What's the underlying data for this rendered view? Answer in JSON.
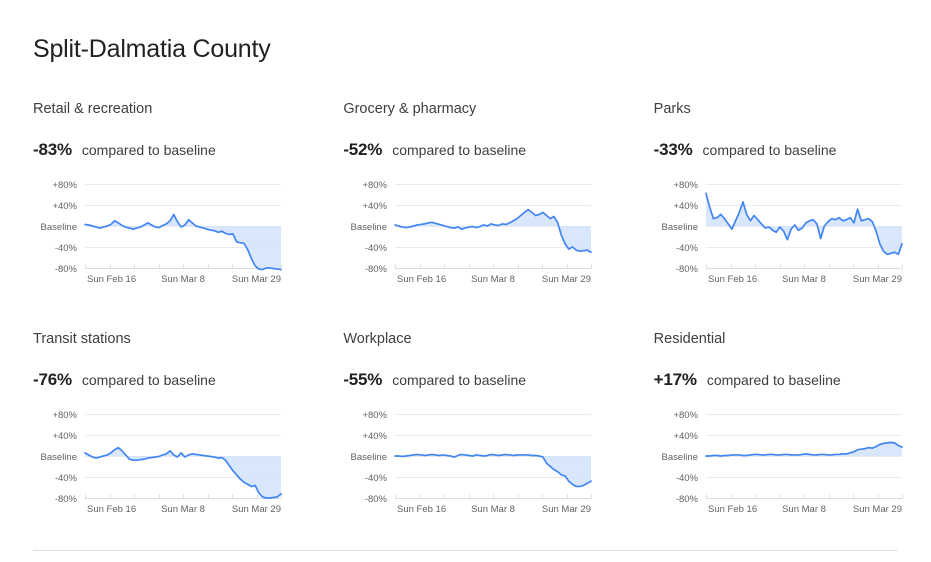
{
  "header": {
    "title": "Split-Dalmatia County"
  },
  "summary_caption": "compared to baseline",
  "axis": {
    "y_ticks": [
      "+80%",
      "+40%",
      "Baseline",
      "-40%",
      "-80%"
    ],
    "y_values": [
      80,
      40,
      0,
      -40,
      -80
    ],
    "x_ticks": [
      "Sun Feb 16",
      "Sun Mar 8",
      "Sun Mar 29"
    ]
  },
  "colors": {
    "line": "#4285f4",
    "area": "#d2e3fc",
    "gridline": "#e8eaed",
    "axis": "#dadce0",
    "text_primary": "#202124",
    "text_secondary": "#5f6368"
  },
  "chart_data": [
    {
      "type": "area",
      "title": "Retail & recreation",
      "value_label": "-83%",
      "caption": "compared to baseline",
      "xlabel": "",
      "ylabel": "",
      "ylim": [
        -80,
        80
      ],
      "grid": true,
      "legend": "none",
      "x_tick_labels": [
        "Sun Feb 16",
        "Sun Mar 8",
        "Sun Mar 29"
      ],
      "y_tick_labels": [
        "+80%",
        "+40%",
        "Baseline",
        "-40%",
        "-80%"
      ],
      "values": [
        3,
        2,
        0,
        -2,
        -4,
        -2,
        0,
        3,
        10,
        6,
        1,
        -2,
        -4,
        -6,
        -4,
        -2,
        2,
        6,
        2,
        -2,
        -3,
        1,
        4,
        10,
        22,
        8,
        -2,
        2,
        12,
        6,
        0,
        -2,
        -4,
        -6,
        -8,
        -9,
        -12,
        -10,
        -14,
        -16,
        -15,
        -30,
        -32,
        -33,
        -45,
        -62,
        -76,
        -82,
        -83,
        -80,
        -80,
        -81,
        -82,
        -83
      ]
    },
    {
      "type": "area",
      "title": "Grocery & pharmacy",
      "value_label": "-52%",
      "caption": "compared to baseline",
      "xlabel": "",
      "ylabel": "",
      "ylim": [
        -80,
        80
      ],
      "grid": true,
      "legend": "none",
      "x_tick_labels": [
        "Sun Feb 16",
        "Sun Mar 8",
        "Sun Mar 29"
      ],
      "y_tick_labels": [
        "+80%",
        "+40%",
        "Baseline",
        "-40%",
        "-80%"
      ],
      "values": [
        2,
        0,
        -2,
        -3,
        -2,
        0,
        2,
        3,
        4,
        6,
        7,
        5,
        3,
        1,
        -1,
        -3,
        -4,
        -2,
        -6,
        -4,
        -2,
        -1,
        -3,
        -1,
        2,
        0,
        4,
        2,
        1,
        4,
        3,
        6,
        10,
        14,
        20,
        26,
        31,
        26,
        20,
        22,
        26,
        20,
        14,
        18,
        6,
        -18,
        -34,
        -44,
        -40,
        -46,
        -48,
        -47,
        -46,
        -50
      ]
    },
    {
      "type": "area",
      "title": "Parks",
      "value_label": "-33%",
      "caption": "compared to baseline",
      "xlabel": "",
      "ylabel": "",
      "ylim": [
        -80,
        80
      ],
      "grid": true,
      "legend": "none",
      "x_tick_labels": [
        "Sun Feb 16",
        "Sun Mar 8",
        "Sun Mar 29"
      ],
      "y_tick_labels": [
        "+80%",
        "+40%",
        "Baseline",
        "-40%",
        "-80%"
      ],
      "values": [
        62,
        36,
        14,
        16,
        22,
        14,
        4,
        -6,
        10,
        26,
        46,
        22,
        10,
        20,
        12,
        4,
        -4,
        -2,
        -8,
        -12,
        -2,
        -10,
        -26,
        -6,
        2,
        -8,
        -4,
        6,
        10,
        12,
        4,
        -24,
        0,
        8,
        14,
        12,
        16,
        10,
        12,
        16,
        6,
        32,
        10,
        12,
        14,
        8,
        -10,
        -34,
        -48,
        -54,
        -52,
        -50,
        -54,
        -34
      ]
    },
    {
      "type": "area",
      "title": "Transit stations",
      "value_label": "-76%",
      "caption": "compared to baseline",
      "xlabel": "",
      "ylabel": "",
      "ylim": [
        -80,
        80
      ],
      "grid": true,
      "legend": "none",
      "x_tick_labels": [
        "Sun Feb 16",
        "Sun Mar 8",
        "Sun Mar 29"
      ],
      "y_tick_labels": [
        "+80%",
        "+40%",
        "Baseline",
        "-40%",
        "-80%"
      ],
      "values": [
        6,
        2,
        -2,
        -4,
        -2,
        0,
        2,
        6,
        12,
        16,
        10,
        2,
        -6,
        -8,
        -8,
        -7,
        -6,
        -4,
        -3,
        -2,
        -1,
        2,
        4,
        10,
        2,
        -2,
        6,
        -2,
        2,
        4,
        3,
        2,
        1,
        0,
        -1,
        -2,
        -4,
        -3,
        -8,
        -18,
        -28,
        -36,
        -44,
        -50,
        -54,
        -58,
        -56,
        -70,
        -78,
        -80,
        -80,
        -79,
        -78,
        -72
      ]
    },
    {
      "type": "area",
      "title": "Workplace",
      "value_label": "-55%",
      "caption": "compared to baseline",
      "xlabel": "",
      "ylabel": "",
      "ylim": [
        -80,
        80
      ],
      "grid": true,
      "legend": "none",
      "x_tick_labels": [
        "Sun Feb 16",
        "Sun Mar 8",
        "Sun Mar 29"
      ],
      "y_tick_labels": [
        "+80%",
        "+40%",
        "Baseline",
        "-40%",
        "-80%"
      ],
      "values": [
        0,
        0,
        -1,
        0,
        1,
        2,
        3,
        2,
        1,
        2,
        3,
        2,
        1,
        2,
        1,
        0,
        -2,
        1,
        3,
        2,
        1,
        0,
        2,
        1,
        0,
        1,
        3,
        2,
        1,
        2,
        3,
        2,
        1,
        2,
        2,
        2,
        2,
        1,
        1,
        0,
        -2,
        -14,
        -20,
        -26,
        -30,
        -36,
        -38,
        -48,
        -54,
        -58,
        -58,
        -56,
        -52,
        -48
      ]
    },
    {
      "type": "area",
      "title": "Residential",
      "value_label": "+17%",
      "caption": "compared to baseline",
      "xlabel": "",
      "ylabel": "",
      "ylim": [
        -80,
        80
      ],
      "grid": true,
      "legend": "none",
      "x_tick_labels": [
        "Sun Feb 16",
        "Sun Mar 8",
        "Sun Mar 29"
      ],
      "y_tick_labels": [
        "+80%",
        "+40%",
        "Baseline",
        "-40%",
        "-80%"
      ],
      "values": [
        0,
        0,
        1,
        1,
        0,
        1,
        1,
        2,
        2,
        2,
        1,
        1,
        2,
        3,
        3,
        2,
        2,
        3,
        3,
        2,
        2,
        3,
        3,
        2,
        2,
        2,
        3,
        4,
        3,
        2,
        2,
        3,
        3,
        2,
        2,
        3,
        3,
        4,
        4,
        6,
        8,
        12,
        13,
        14,
        16,
        15,
        18,
        22,
        24,
        25,
        26,
        25,
        20,
        17
      ]
    }
  ]
}
